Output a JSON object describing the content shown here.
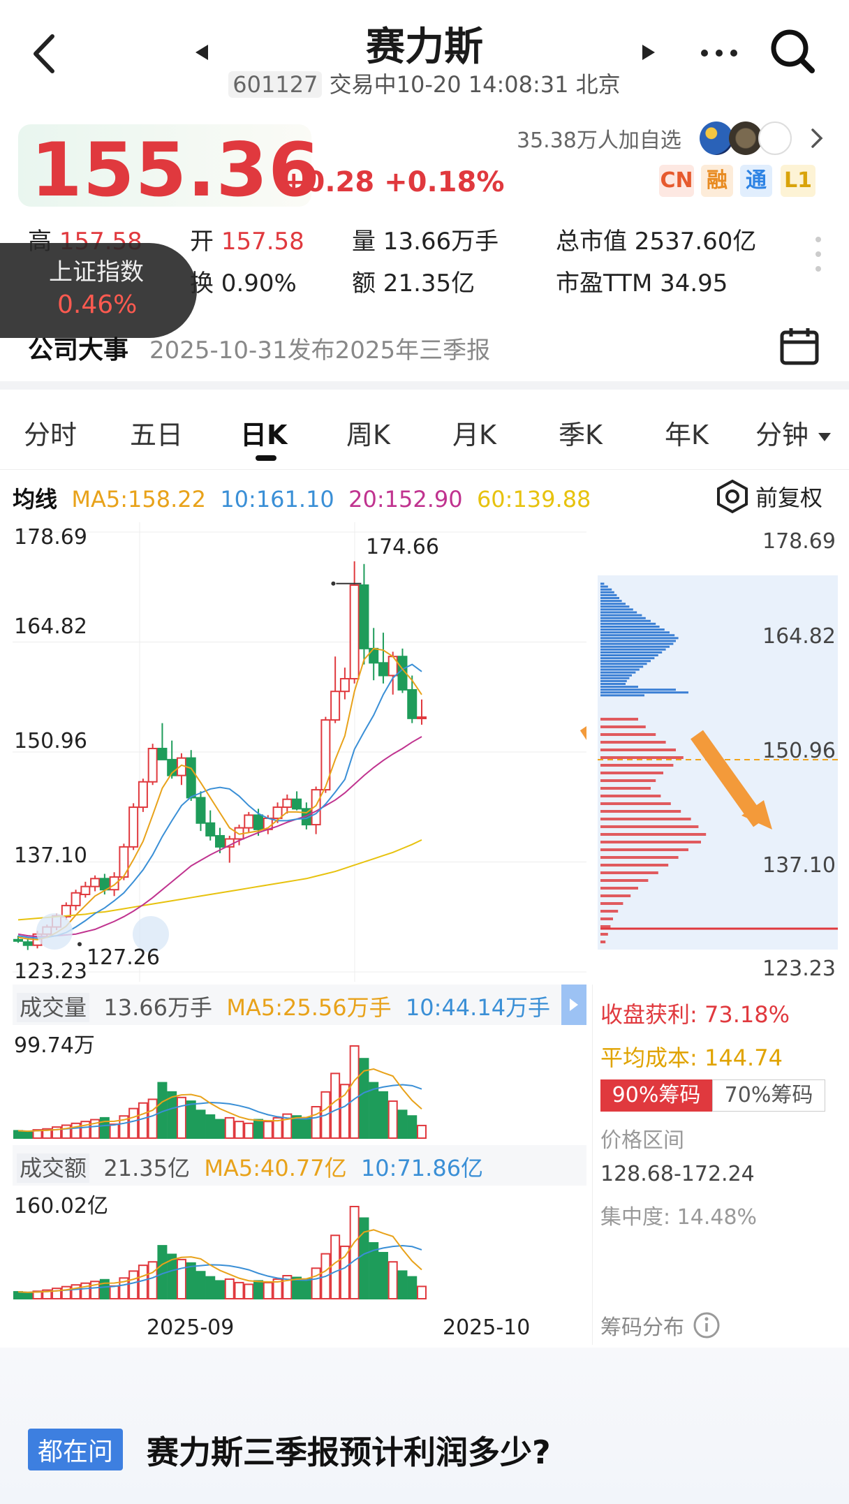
{
  "header": {
    "title": "赛力斯",
    "code": "601127",
    "status": "交易中10-20 14:08:31 北京"
  },
  "quote": {
    "price": "155.36",
    "change": "+0.28 +0.18%",
    "followers": "35.38万人加自选",
    "badges": [
      "CN",
      "融",
      "通",
      "L1"
    ]
  },
  "stats": {
    "high_label": "高",
    "high_value": "157.58",
    "open_label": "开",
    "open_value": "157.58",
    "volume": "量 13.66万手",
    "mktcap": "总市值 2537.60亿",
    "turnover": "换 0.90%",
    "amount": "额 21.35亿",
    "pe": "市盈TTM 34.95"
  },
  "index_toast": {
    "name": "上证指数",
    "value": "0.46%"
  },
  "event": {
    "label": "公司大事",
    "text": "2025-10-31发布2025年三季报"
  },
  "tabs": [
    "分时",
    "五日",
    "日K",
    "周K",
    "月K",
    "季K",
    "年K",
    "分钟"
  ],
  "ma": {
    "label": "均线",
    "ma5": "MA5:158.22",
    "ma10": "10:161.10",
    "ma20": "20:152.90",
    "ma60": "60:139.88",
    "adjust": "前复权"
  },
  "price_axis": [
    "178.69",
    "164.82",
    "150.96",
    "137.10",
    "123.23"
  ],
  "price_axis_right": [
    "178.69",
    "164.82",
    "150.96",
    "137.10",
    "123.23"
  ],
  "annotations": {
    "high": "174.66",
    "low": "127.26"
  },
  "volume": {
    "label": "成交量",
    "value": "13.66万手",
    "ma5": "MA5:25.56万手",
    "ma10": "10:44.14万手",
    "max": "99.74万"
  },
  "amount": {
    "label": "成交额",
    "value": "21.35亿",
    "ma5": "MA5:40.77亿",
    "ma10": "10:71.86亿",
    "max": "160.02亿"
  },
  "dates": [
    "2025-09",
    "2025-10"
  ],
  "chips": {
    "profit_label": "收盘获利:",
    "profit_value": "73.18%",
    "avg_label": "平均成本:",
    "avg_value": "144.74",
    "tab90": "90%筹码",
    "tab70": "70%筹码",
    "range_label": "价格区间",
    "range_value": "128.68-172.24",
    "concentration": "集中度: 14.48%",
    "footer": "筹码分布"
  },
  "ask": {
    "tag": "都在问",
    "question": "赛力斯三季报预计利润多少?"
  },
  "colors": {
    "up": "#e0393e",
    "down": "#1e9c5a",
    "ma5": "#e8a21a",
    "ma10": "#3a8fd6",
    "ma20": "#c0338f",
    "ma60": "#e7c20e"
  },
  "chart_data": {
    "type": "candlestick",
    "candles": [
      [
        127.3,
        127.8,
        126.9,
        127.2
      ],
      [
        127.0,
        127.5,
        126.0,
        126.6
      ],
      [
        126.6,
        128.4,
        126.2,
        128.0
      ],
      [
        128.0,
        129.2,
        127.6,
        128.9
      ],
      [
        128.9,
        130.6,
        128.5,
        130.3
      ],
      [
        130.2,
        132.0,
        129.8,
        131.6
      ],
      [
        131.6,
        133.6,
        131.0,
        133.2
      ],
      [
        133.0,
        134.6,
        132.6,
        134.0
      ],
      [
        134.0,
        135.4,
        133.4,
        135.0
      ],
      [
        135.0,
        135.6,
        133.0,
        133.6
      ],
      [
        133.6,
        135.8,
        132.8,
        135.2
      ],
      [
        135.2,
        139.4,
        134.8,
        139.0
      ],
      [
        139.0,
        144.5,
        138.6,
        144.0
      ],
      [
        144.0,
        147.6,
        143.4,
        147.2
      ],
      [
        147.2,
        152.0,
        146.8,
        151.4
      ],
      [
        151.4,
        154.6,
        150.6,
        150.0
      ],
      [
        150.0,
        152.4,
        147.6,
        148.0
      ],
      [
        148.0,
        150.8,
        146.8,
        150.2
      ],
      [
        150.2,
        151.2,
        144.8,
        145.2
      ],
      [
        145.2,
        146.0,
        141.0,
        142.0
      ],
      [
        142.0,
        143.6,
        139.8,
        140.4
      ],
      [
        140.4,
        141.4,
        138.2,
        139.0
      ],
      [
        139.0,
        140.4,
        137.0,
        140.0
      ],
      [
        140.0,
        141.8,
        139.2,
        141.4
      ],
      [
        141.4,
        143.4,
        140.8,
        143.0
      ],
      [
        143.0,
        143.8,
        140.4,
        141.2
      ],
      [
        141.2,
        143.0,
        140.6,
        142.6
      ],
      [
        142.6,
        144.6,
        142.0,
        144.0
      ],
      [
        144.0,
        145.6,
        143.2,
        145.0
      ],
      [
        145.0,
        146.0,
        143.6,
        143.8
      ],
      [
        143.8,
        144.6,
        141.2,
        141.8
      ],
      [
        141.8,
        146.6,
        140.6,
        146.2
      ],
      [
        146.2,
        155.4,
        145.8,
        155.0
      ],
      [
        155.0,
        163.0,
        154.6,
        158.6
      ],
      [
        158.6,
        161.6,
        157.6,
        160.2
      ],
      [
        160.2,
        175.0,
        159.6,
        172.0
      ],
      [
        172.0,
        174.66,
        162.0,
        164.0
      ],
      [
        164.0,
        166.6,
        160.0,
        162.2
      ],
      [
        162.2,
        166.0,
        159.6,
        160.6
      ],
      [
        160.6,
        163.6,
        158.2,
        163.0
      ],
      [
        163.0,
        164.0,
        158.4,
        158.8
      ],
      [
        158.8,
        160.6,
        154.6,
        155.2
      ],
      [
        155.2,
        157.58,
        154.4,
        155.36
      ]
    ],
    "ma5": [
      127.6,
      127.4,
      127.3,
      127.6,
      128.2,
      129.0,
      130.4,
      131.6,
      132.8,
      133.5,
      134.2,
      135.3,
      137.4,
      139.7,
      143.0,
      146.4,
      148.3,
      149.3,
      148.9,
      147.1,
      145.2,
      143.3,
      141.4,
      140.6,
      140.8,
      141.0,
      141.4,
      142.4,
      143.4,
      143.4,
      143.3,
      144.2,
      146.6,
      150.0,
      153.0,
      158.6,
      162.6,
      164.0,
      163.8,
      163.0,
      161.4,
      160.0,
      158.2
    ],
    "ma10": [
      127.8,
      127.6,
      127.5,
      127.6,
      127.8,
      128.2,
      128.9,
      129.7,
      130.6,
      131.3,
      132.2,
      133.2,
      134.6,
      136.1,
      138.0,
      140.3,
      142.3,
      144.2,
      145.3,
      145.8,
      146.3,
      146.5,
      146.3,
      145.4,
      144.2,
      143.2,
      142.6,
      142.3,
      142.3,
      142.5,
      142.6,
      143.2,
      144.4,
      145.9,
      147.5,
      151.3,
      153.5,
      155.6,
      158.2,
      160.3,
      161.4,
      162.0,
      161.1
    ],
    "ma20": [
      128.0,
      127.8,
      127.7,
      127.7,
      127.8,
      127.9,
      128.0,
      128.3,
      128.6,
      129.1,
      129.6,
      130.2,
      130.9,
      131.7,
      132.6,
      133.6,
      134.6,
      135.6,
      136.6,
      137.3,
      138.0,
      138.6,
      139.2,
      139.8,
      140.3,
      140.8,
      141.2,
      141.6,
      142.1,
      142.5,
      142.9,
      143.5,
      144.2,
      144.9,
      145.8,
      146.9,
      148.0,
      149.0,
      149.9,
      150.7,
      151.4,
      152.2,
      152.9
    ],
    "ma60": [
      129.8,
      129.9,
      130.0,
      130.1,
      130.2,
      130.3,
      130.4,
      130.5,
      130.7,
      130.8,
      131.0,
      131.2,
      131.4,
      131.6,
      131.8,
      132.0,
      132.2,
      132.4,
      132.6,
      132.8,
      133.0,
      133.2,
      133.4,
      133.6,
      133.8,
      134.0,
      134.2,
      134.4,
      134.6,
      134.8,
      135.0,
      135.3,
      135.6,
      135.9,
      136.3,
      136.7,
      137.1,
      137.5,
      137.9,
      138.3,
      138.8,
      139.3,
      139.88
    ],
    "volume_wan": [
      8,
      7,
      9,
      10,
      12,
      14,
      16,
      18,
      20,
      22,
      15,
      24,
      32,
      38,
      42,
      60,
      50,
      44,
      40,
      30,
      25,
      20,
      22,
      18,
      16,
      20,
      18,
      22,
      26,
      24,
      22,
      34,
      50,
      70,
      58,
      99.74,
      86,
      60,
      50,
      40,
      30,
      24,
      13.66
    ],
    "amount_yi": [
      12,
      10,
      13,
      15,
      18,
      21,
      24,
      27,
      30,
      33,
      22,
      36,
      48,
      58,
      64,
      92,
      77,
      68,
      62,
      47,
      38,
      31,
      34,
      28,
      25,
      31,
      28,
      34,
      40,
      37,
      34,
      53,
      78,
      110,
      91,
      160.02,
      140,
      97,
      80,
      64,
      48,
      38,
      21.35
    ],
    "chip_up": [
      6,
      12,
      18,
      22,
      26,
      30,
      34,
      40,
      46,
      52,
      58,
      66,
      72,
      80,
      88,
      94,
      102,
      110,
      118,
      124,
      120,
      116,
      110,
      104,
      98,
      92,
      86,
      80,
      74,
      68,
      62,
      56,
      50,
      46,
      42,
      40,
      60,
      120,
      140,
      70
    ],
    "chip_down": [
      30,
      36,
      44,
      52,
      60,
      66,
      58,
      50,
      44,
      40,
      48,
      56,
      64,
      72,
      78,
      84,
      80,
      70,
      62,
      54,
      46,
      38,
      30,
      24,
      18,
      14,
      10,
      8,
      6,
      4
    ]
  }
}
